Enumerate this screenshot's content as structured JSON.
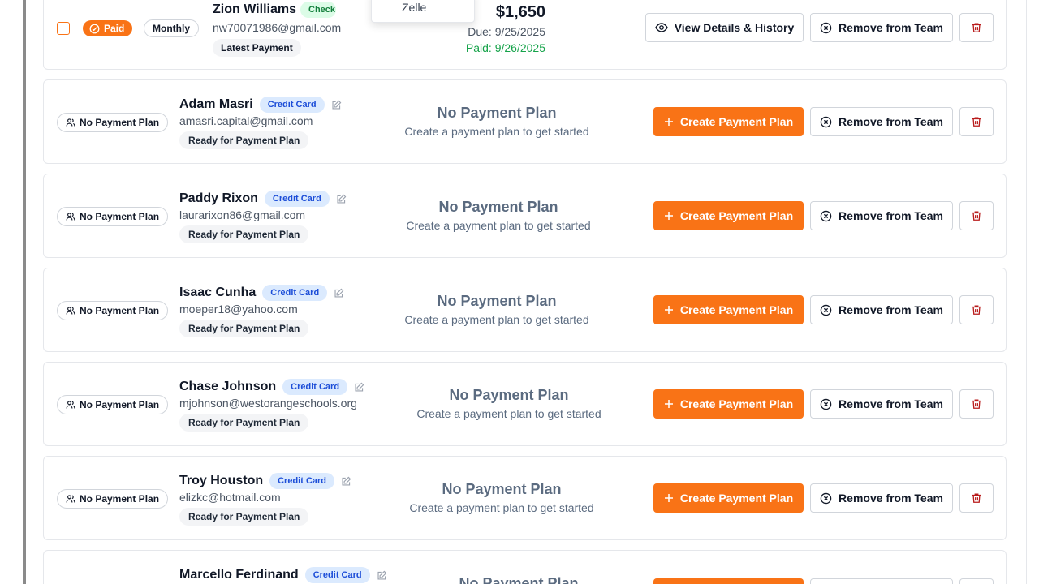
{
  "dropdown": {
    "items": [
      "Zelle"
    ]
  },
  "first_player": {
    "status": "Paid",
    "frequency": "Monthly",
    "name": "Zion Williams",
    "method_badge": "Check",
    "email": "nw70071986@gmail.com",
    "tag": "Latest Payment",
    "amount": "$1,650",
    "due": "Due: 9/25/2025",
    "paid": "Paid: 9/26/2025",
    "details_label": "View Details & History",
    "remove_label": "Remove from Team"
  },
  "labels": {
    "no_plan_pill": "No Payment Plan",
    "method_badge": "Credit Card",
    "ready_tag": "Ready for Payment Plan",
    "no_plan_title": "No Payment Plan",
    "no_plan_subtitle": "Create a payment plan to get started",
    "create_label": "Create Payment Plan",
    "remove_label": "Remove from Team"
  },
  "players": [
    {
      "name": "Adam Masri",
      "email": "amasri.capital@gmail.com"
    },
    {
      "name": "Paddy Rixon",
      "email": "laurarixon86@gmail.com"
    },
    {
      "name": "Isaac Cunha",
      "email": "moeper18@yahoo.com"
    },
    {
      "name": "Chase Johnson",
      "email": "mjohnson@westorangeschools.org"
    },
    {
      "name": "Troy Houston",
      "email": "elizkc@hotmail.com"
    },
    {
      "name": "Marcello Ferdinand",
      "email": ""
    }
  ],
  "colors": {
    "accent": "#f97316",
    "muted_slate": "#5b6b80",
    "paid_green": "#16a34a",
    "credit_card_badge_bg": "#dbeafe",
    "danger": "#b91c1c"
  }
}
